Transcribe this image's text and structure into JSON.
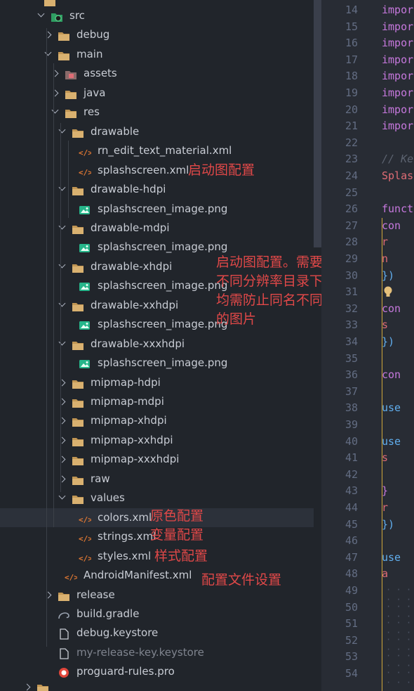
{
  "explorer": {
    "rows": [
      {
        "label": "src",
        "kind": "src-folder",
        "chevron": "open"
      },
      {
        "label": "debug",
        "kind": "folder",
        "chevron": "closed"
      },
      {
        "label": "main",
        "kind": "folder",
        "chevron": "open"
      },
      {
        "label": "assets",
        "kind": "assets-folder",
        "chevron": "closed"
      },
      {
        "label": "java",
        "kind": "folder",
        "chevron": "closed"
      },
      {
        "label": "res",
        "kind": "folder",
        "chevron": "open"
      },
      {
        "label": "drawable",
        "kind": "folder",
        "chevron": "open"
      },
      {
        "label": "rn_edit_text_material.xml",
        "kind": "xml"
      },
      {
        "label": "splashscreen.xml",
        "kind": "xml"
      },
      {
        "label": "drawable-hdpi",
        "kind": "folder",
        "chevron": "open"
      },
      {
        "label": "splashscreen_image.png",
        "kind": "png"
      },
      {
        "label": "drawable-mdpi",
        "kind": "folder",
        "chevron": "open"
      },
      {
        "label": "splashscreen_image.png",
        "kind": "png"
      },
      {
        "label": "drawable-xhdpi",
        "kind": "folder",
        "chevron": "open"
      },
      {
        "label": "splashscreen_image.png",
        "kind": "png"
      },
      {
        "label": "drawable-xxhdpi",
        "kind": "folder",
        "chevron": "open"
      },
      {
        "label": "splashscreen_image.png",
        "kind": "png"
      },
      {
        "label": "drawable-xxxhdpi",
        "kind": "folder",
        "chevron": "open"
      },
      {
        "label": "splashscreen_image.png",
        "kind": "png"
      },
      {
        "label": "mipmap-hdpi",
        "kind": "folder",
        "chevron": "closed"
      },
      {
        "label": "mipmap-mdpi",
        "kind": "folder",
        "chevron": "closed"
      },
      {
        "label": "mipmap-xhdpi",
        "kind": "folder",
        "chevron": "closed"
      },
      {
        "label": "mipmap-xxhdpi",
        "kind": "folder",
        "chevron": "closed"
      },
      {
        "label": "mipmap-xxxhdpi",
        "kind": "folder",
        "chevron": "closed"
      },
      {
        "label": "raw",
        "kind": "folder",
        "chevron": "closed"
      },
      {
        "label": "values",
        "kind": "folder",
        "chevron": "open"
      },
      {
        "label": "colors.xml",
        "kind": "xml"
      },
      {
        "label": "strings.xml",
        "kind": "xml"
      },
      {
        "label": "styles.xml",
        "kind": "xml"
      },
      {
        "label": "AndroidManifest.xml",
        "kind": "xml"
      },
      {
        "label": "release",
        "kind": "folder",
        "chevron": "closed"
      },
      {
        "label": "build.gradle",
        "kind": "gradle"
      },
      {
        "label": "debug.keystore",
        "kind": "file"
      },
      {
        "label": "my-release-key.keystore",
        "kind": "file",
        "dim": true
      },
      {
        "label": "proguard-rules.pro",
        "kind": "pro"
      }
    ]
  },
  "annotations": {
    "splash_xml": "启动图配置",
    "splash_png_lines": [
      "启动图配置。需要注意的是",
      "不同分辨率目录下",
      "均需防止同名不同分辨率",
      "的图片"
    ],
    "colors": "原色配置",
    "strings": "变量配置",
    "styles": "样式配置",
    "manifest": "配置文件设置"
  },
  "editor": {
    "lines": [
      {
        "n": "14",
        "code": "impor",
        "cls": "kw"
      },
      {
        "n": "15",
        "code": "impor",
        "cls": "kw"
      },
      {
        "n": "16",
        "code": "impor",
        "cls": "kw"
      },
      {
        "n": "17",
        "code": "impor",
        "cls": "kw"
      },
      {
        "n": "18",
        "code": "impor",
        "cls": "kw"
      },
      {
        "n": "19",
        "code": "impor",
        "cls": "kw"
      },
      {
        "n": "20",
        "code": "impor",
        "cls": "kw"
      },
      {
        "n": "21",
        "code": "impor",
        "cls": "kw"
      },
      {
        "n": "22",
        "code": "",
        "cls": ""
      },
      {
        "n": "23",
        "code": "// Ke",
        "cls": "cm"
      },
      {
        "n": "24",
        "code": "Splas",
        "cls": "fn"
      },
      {
        "n": "25",
        "code": "",
        "cls": ""
      },
      {
        "n": "26",
        "code": "funct",
        "cls": "kw"
      },
      {
        "n": "27",
        "code": "  con",
        "cls": "kw"
      },
      {
        "n": "28",
        "code": "    r",
        "cls": "fn"
      },
      {
        "n": "29",
        "code": "    n",
        "cls": "fn"
      },
      {
        "n": "30",
        "code": "  })",
        "cls": "pl"
      },
      {
        "n": "31",
        "code": "",
        "cls": ""
      },
      {
        "n": "32",
        "code": "  con",
        "cls": "kw"
      },
      {
        "n": "33",
        "code": "    s",
        "cls": "fn"
      },
      {
        "n": "34",
        "code": "  })",
        "cls": "pl"
      },
      {
        "n": "35",
        "code": "",
        "cls": ""
      },
      {
        "n": "36",
        "code": "  con",
        "cls": "kw"
      },
      {
        "n": "37",
        "code": "",
        "cls": ""
      },
      {
        "n": "38",
        "code": "  use",
        "cls": "pl"
      },
      {
        "n": "39",
        "code": "",
        "cls": ""
      },
      {
        "n": "40",
        "code": "  use",
        "cls": "pl"
      },
      {
        "n": "41",
        "code": "    s",
        "cls": "fn"
      },
      {
        "n": "42",
        "code": "",
        "cls": ""
      },
      {
        "n": "43",
        "code": "    }",
        "cls": "kw"
      },
      {
        "n": "44",
        "code": "    r",
        "cls": "fn"
      },
      {
        "n": "45",
        "code": "  })",
        "cls": "pl"
      },
      {
        "n": "46",
        "code": "",
        "cls": ""
      },
      {
        "n": "47",
        "code": "  use",
        "cls": "pl"
      },
      {
        "n": "48",
        "code": "    a",
        "cls": "fn"
      },
      {
        "n": "49",
        "code": "",
        "cls": ""
      },
      {
        "n": "50",
        "code": "",
        "cls": ""
      },
      {
        "n": "51",
        "code": "",
        "cls": ""
      },
      {
        "n": "52",
        "code": "",
        "cls": ""
      },
      {
        "n": "53",
        "code": "",
        "cls": ""
      },
      {
        "n": "54",
        "code": "",
        "cls": ""
      }
    ]
  }
}
